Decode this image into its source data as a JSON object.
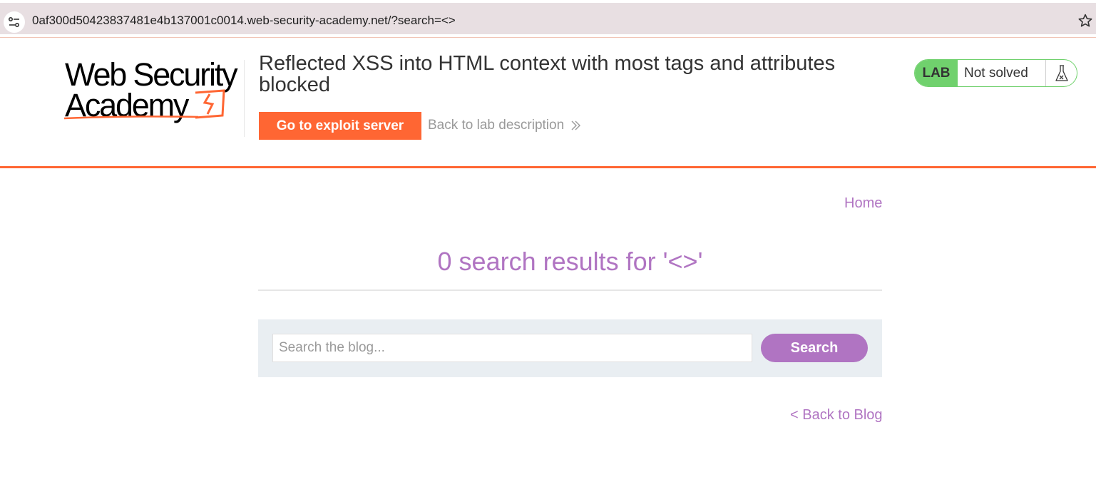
{
  "browser": {
    "url": "0af300d50423837481e4b137001c0014.web-security-academy.net/?search=<>",
    "site_icon": "site-info-icon",
    "bookmark_icon": "star-icon"
  },
  "header": {
    "logo_line1": "Web Security",
    "logo_line2": "Academy",
    "lab_title": "Reflected XSS into HTML context with most tags and attributes blocked",
    "exploit_button": "Go to exploit server",
    "back_to_description": "Back to lab description",
    "status_badge": "LAB",
    "status_text": "Not solved"
  },
  "blog": {
    "home_link": "Home",
    "results_heading": "0 search results for '<>'",
    "search_placeholder": "Search the blog...",
    "search_value": "",
    "search_button": "Search",
    "back_link": "< Back to Blog"
  },
  "colors": {
    "accent_orange": "#ff6633",
    "link_purple": "#b074c2",
    "status_green": "#70d16d",
    "panel_bg": "#e9eef2"
  }
}
